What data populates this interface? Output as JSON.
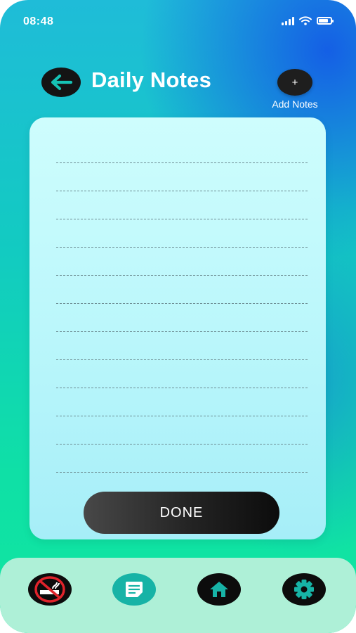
{
  "status_bar": {
    "time": "08:48",
    "icons": [
      "cellular-signal-icon",
      "wifi-icon",
      "battery-icon"
    ]
  },
  "header": {
    "back_icon": "arrow-left-icon",
    "title": "Daily Notes",
    "add_button_symbol": "+",
    "add_label": "Add Notes"
  },
  "note_card": {
    "line_count": 12,
    "done_label": "DONE"
  },
  "bottom_nav": {
    "items": [
      {
        "name": "no-smoking-icon",
        "active": false
      },
      {
        "name": "notes-icon",
        "active": true
      },
      {
        "name": "home-icon",
        "active": false
      },
      {
        "name": "settings-gear-icon",
        "active": false
      }
    ]
  },
  "colors": {
    "accent_dark": "#0c0c0c",
    "nav_active": "#17b3a6",
    "nav_bar": "#aef0d7",
    "card": "#bbf7fb",
    "gradient_blue": "#145ae6",
    "gradient_green": "#10e6a0",
    "no_smoking_red": "#e0232b"
  }
}
